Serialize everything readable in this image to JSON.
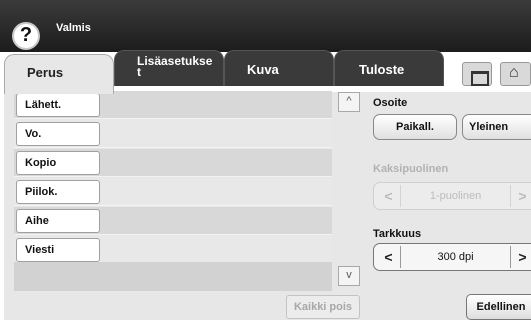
{
  "status": {
    "help_icon": "?",
    "text": "Valmis"
  },
  "tabs": [
    {
      "label": "Perus",
      "active": true
    },
    {
      "label": "Lisäasetukse t",
      "active": false
    },
    {
      "label": "Kuva",
      "active": false
    },
    {
      "label": "Tuloste",
      "active": false
    }
  ],
  "tab_icons": [
    "folder-icon",
    "home-icon"
  ],
  "fields": [
    {
      "label": "Lähett."
    },
    {
      "label": "Vo."
    },
    {
      "label": "Kopio"
    },
    {
      "label": "Piilok."
    },
    {
      "label": "Aihe"
    },
    {
      "label": "Viesti"
    }
  ],
  "scroll": {
    "up": "^",
    "down": "v"
  },
  "clear_all_label": "Kaikki pois",
  "address": {
    "label": "Osoite",
    "local": "Paikall.",
    "global": "Yleinen"
  },
  "duplex": {
    "label": "Kaksipuolinen",
    "value": "1-puolinen",
    "left": "<",
    "right": ">",
    "enabled": false
  },
  "resolution": {
    "label": "Tarkkuus",
    "value": "300 dpi",
    "left": "<",
    "right": ">"
  },
  "back_label": "Edellinen",
  "colors": {
    "topbar": "#2a2a2a",
    "panel": "#e7e7e7",
    "disabled_text": "#b2b2b2"
  }
}
